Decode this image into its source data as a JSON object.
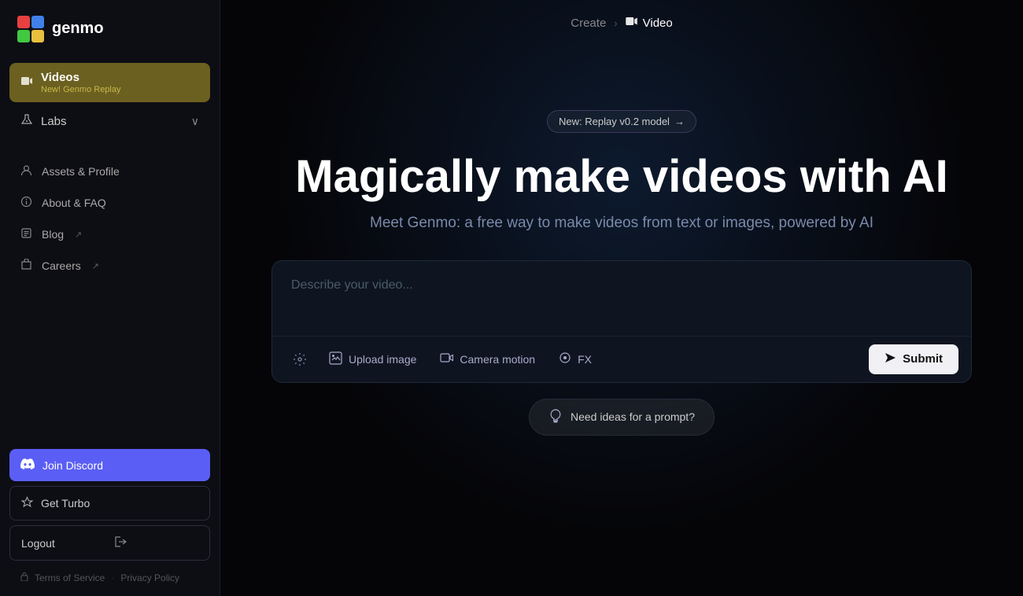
{
  "sidebar": {
    "logo_text": "genmo",
    "nav": {
      "videos_label": "Videos",
      "videos_sublabel": "New! Genmo Replay",
      "labs_label": "Labs"
    },
    "links": [
      {
        "id": "assets-profile",
        "label": "Assets & Profile"
      },
      {
        "id": "about-faq",
        "label": "About & FAQ"
      },
      {
        "id": "blog",
        "label": "Blog",
        "external": true
      },
      {
        "id": "careers",
        "label": "Careers",
        "external": true
      }
    ],
    "join_discord_label": "Join Discord",
    "get_turbo_label": "Get Turbo",
    "logout_label": "Logout",
    "footer": {
      "terms_label": "Terms of Service",
      "privacy_label": "Privacy Policy"
    }
  },
  "breadcrumb": {
    "create_label": "Create",
    "separator": "›",
    "video_label": "Video"
  },
  "hero": {
    "badge_text": "New: Replay v0.2 model",
    "badge_arrow": "→",
    "title": "Magically make videos with AI",
    "subtitle": "Meet Genmo: a free way to make videos from text or images, powered by AI"
  },
  "prompt": {
    "placeholder": "Describe your video...",
    "upload_image_label": "Upload image",
    "camera_motion_label": "Camera motion",
    "fx_label": "FX",
    "submit_label": "Submit",
    "ideas_label": "Need ideas for a prompt?"
  }
}
